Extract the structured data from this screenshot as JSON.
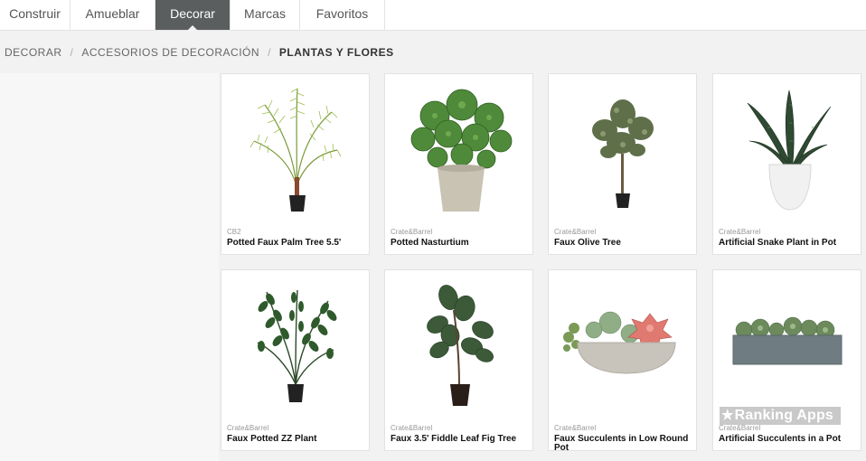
{
  "nav": {
    "tabs": [
      {
        "label": "Construir"
      },
      {
        "label": "Amueblar"
      },
      {
        "label": "Decorar",
        "active": true
      },
      {
        "label": "Marcas"
      },
      {
        "label": "Favoritos"
      }
    ]
  },
  "breadcrumb": {
    "items": [
      "DECORAR",
      "ACCESORIOS DE DECORACIÓN",
      "PLANTAS Y FLORES"
    ],
    "separator": "/"
  },
  "products": [
    {
      "brand": "CB2",
      "name": "Potted Faux Palm Tree 5.5'",
      "icon": "palm-plant-icon"
    },
    {
      "brand": "Crate&Barrel",
      "name": "Potted Nasturtium",
      "icon": "nasturtium-plant-icon"
    },
    {
      "brand": "Crate&Barrel",
      "name": "Faux Olive Tree",
      "icon": "olive-tree-icon"
    },
    {
      "brand": "Crate&Barrel",
      "name": "Artificial Snake Plant in Pot",
      "icon": "snake-plant-icon"
    },
    {
      "brand": "Crate&Barrel",
      "name": "Faux Potted ZZ Plant",
      "icon": "zz-plant-icon"
    },
    {
      "brand": "Crate&Barrel",
      "name": "Faux 3.5' Fiddle Leaf Fig Tree",
      "icon": "fiddle-leaf-fig-icon"
    },
    {
      "brand": "Crate&Barrel",
      "name": "Faux Succulents in Low Round Pot",
      "icon": "succulent-bowl-icon"
    },
    {
      "brand": "Crate&Barrel",
      "name": "Artificial Succulents in a Pot",
      "icon": "succulent-planter-icon"
    }
  ],
  "watermark": {
    "text": "Ranking Apps"
  },
  "colors": {
    "active_tab": "#5b5e5f",
    "background": "#f2f2f2",
    "card": "#ffffff"
  }
}
